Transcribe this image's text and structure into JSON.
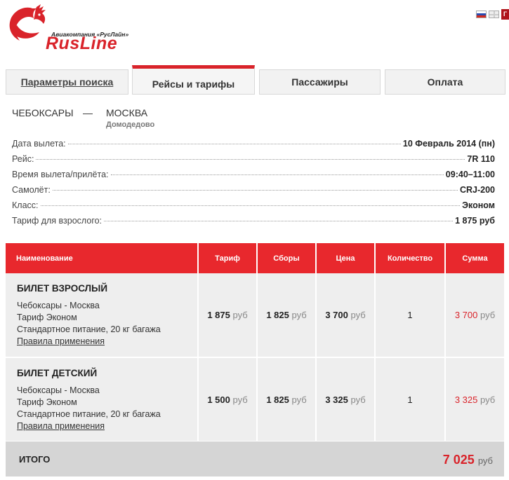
{
  "brand": {
    "tagline": "Авиакомпания «РусЛайн»",
    "name": "RusLine",
    "lang_label": "Г"
  },
  "tabs": [
    {
      "label": "Параметры поиска"
    },
    {
      "label": "Рейсы и тарифы"
    },
    {
      "label": "Пассажиры"
    },
    {
      "label": "Оплата"
    }
  ],
  "route": {
    "from": "ЧЕБОКСАРЫ",
    "dash": "—",
    "to": "МОСКВА",
    "airport": "Домодедово"
  },
  "info": [
    {
      "label": "Дата вылета:",
      "value": "10 Февраль 2014 (пн)"
    },
    {
      "label": "Рейс:",
      "value": "7R 110"
    },
    {
      "label": "Время вылета/прилёта:",
      "value": "09:40–11:00"
    },
    {
      "label": "Самолёт:",
      "value": "CRJ-200"
    },
    {
      "label": "Класс:",
      "value": "Эконом"
    },
    {
      "label": "Тариф для взрослого:",
      "value": "1 875 руб"
    }
  ],
  "table": {
    "headers": [
      "Наименование",
      "Тариф",
      "Сборы",
      "Цена",
      "Количество",
      "Сумма"
    ],
    "currency": "руб",
    "rows": [
      {
        "title": "БИЛЕТ ВЗРОСЛЫЙ",
        "route": "Чебоксары - Москва",
        "fare": "Тариф Эконом",
        "extras": "Стандартное питание, 20 кг багажа",
        "rules_link": "Правила применения",
        "tariff": "1 875",
        "fees": "1 825",
        "price": "3 700",
        "qty": "1",
        "sum": "3 700"
      },
      {
        "title": "БИЛЕТ ДЕТСКИЙ",
        "route": "Чебоксары - Москва",
        "fare": "Тариф Эконом",
        "extras": "Стандартное питание, 20 кг багажа",
        "rules_link": "Правила применения",
        "tariff": "1 500",
        "fees": "1 825",
        "price": "3 325",
        "qty": "1",
        "sum": "3 325"
      }
    ]
  },
  "total": {
    "label": "ИТОГО",
    "amount": "7 025",
    "currency": "руб"
  },
  "colors": {
    "accent": "#e8282d",
    "brand_red": "#d9232a"
  },
  "icons": [
    "rooster-logo-icon",
    "flag-ru-icon",
    "flag-en-icon"
  ]
}
